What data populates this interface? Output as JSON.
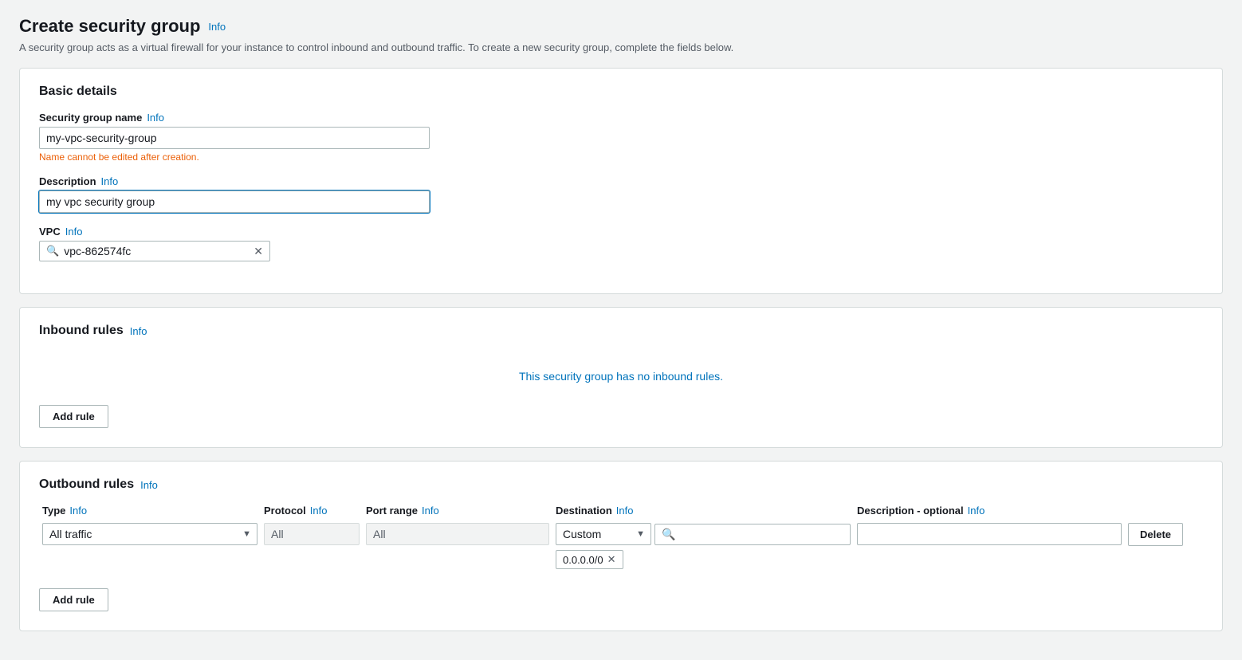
{
  "page": {
    "title": "Create security group",
    "info_link": "Info",
    "description": "A security group acts as a virtual firewall for your instance to control inbound and outbound traffic. To create a new security group, complete the fields below."
  },
  "basic_details": {
    "section_title": "Basic details",
    "info_link": "Info",
    "sg_name_label": "Security group name",
    "sg_name_info": "Info",
    "sg_name_value": "my-vpc-security-group",
    "sg_name_hint": "Name cannot be edited after creation.",
    "description_label": "Description",
    "description_info": "Info",
    "description_value": "my vpc security group",
    "vpc_label": "VPC",
    "vpc_info": "Info",
    "vpc_value": "vpc-862574fc"
  },
  "inbound_rules": {
    "section_title": "Inbound rules",
    "info_link": "Info",
    "empty_msg": "This security group has no inbound rules.",
    "add_rule_label": "Add rule"
  },
  "outbound_rules": {
    "section_title": "Outbound rules",
    "info_link": "Info",
    "col_type": "Type",
    "col_type_info": "Info",
    "col_protocol": "Protocol",
    "col_protocol_info": "Info",
    "col_port_range": "Port range",
    "col_port_range_info": "Info",
    "col_destination": "Destination",
    "col_destination_info": "Info",
    "col_description": "Description - optional",
    "col_description_info": "Info",
    "row": {
      "type_value": "All traffic",
      "protocol_value": "All",
      "port_range_value": "All",
      "destination_select": "Custom",
      "destination_search_placeholder": "",
      "cidr": "0.0.0.0/0",
      "description_value": "",
      "delete_label": "Delete"
    },
    "add_rule_label": "Add rule"
  }
}
